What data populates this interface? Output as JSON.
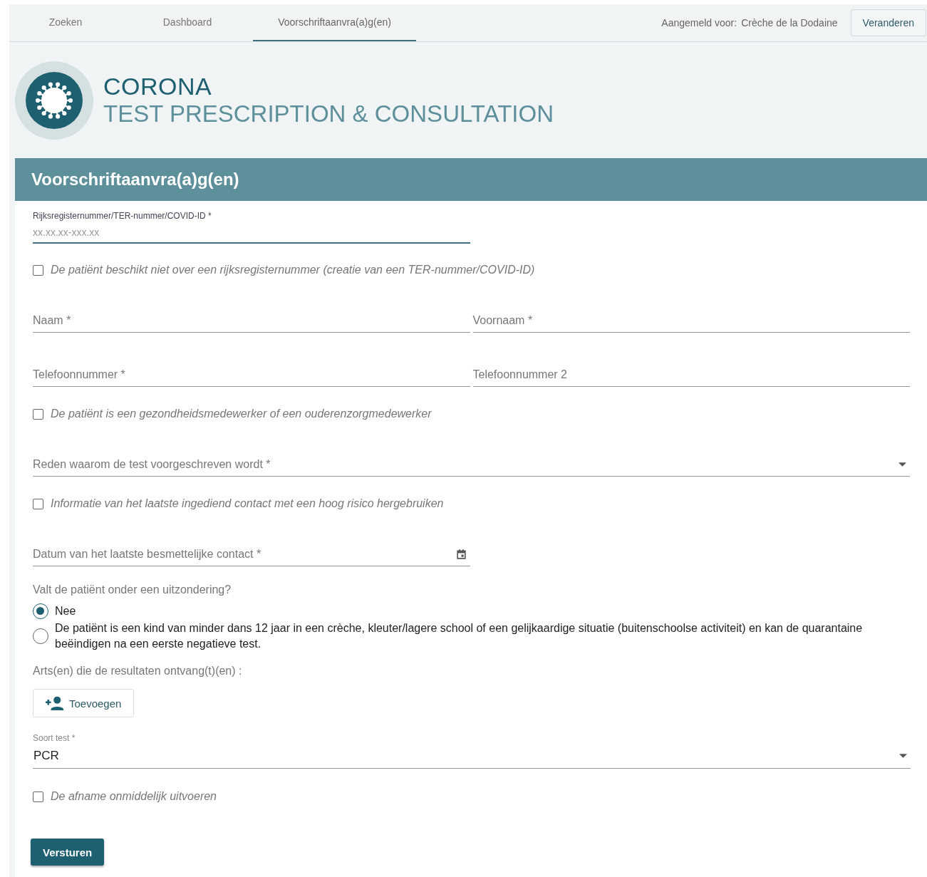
{
  "tabs": [
    {
      "label": "Zoeken",
      "selected": false
    },
    {
      "label": "Dashboard",
      "selected": false
    },
    {
      "label": "Voorschriftaanvra(a)g(en)",
      "selected": true
    }
  ],
  "login": {
    "label": "Aangemeld voor:",
    "value": "Crèche de la Dodaine",
    "button": "Veranderen"
  },
  "header": {
    "title": "CORONA",
    "subtitle": "TEST PRESCRIPTION & CONSULTATION"
  },
  "form": {
    "title": "Voorschriftaanvra(a)g(en)",
    "items": [
      {
        "kind": "focused-text",
        "label": "Rijksregisternummer/TER-nummer/COVID-ID *",
        "placeholder": "xx.xx.xx-xxx.xx"
      },
      {
        "kind": "checkbox",
        "label": "De patiënt beschikt niet over een rijksregisternummer (creatie van een TER-nummer/COVID-ID)",
        "checked": false
      },
      {
        "kind": "pair",
        "fields": [
          {
            "label": "Naam *"
          },
          {
            "label": "Voornaam *"
          }
        ]
      },
      {
        "kind": "pair",
        "fields": [
          {
            "label": "Telefoonnummer *"
          },
          {
            "label": "Telefoonnummer 2"
          }
        ]
      },
      {
        "kind": "checkbox",
        "label": "De patiënt is een gezondheidsmedewerker of een ouderenzorgmedewerker",
        "checked": false
      },
      {
        "kind": "select",
        "label": "Reden waarom de test voorgeschreven wordt *"
      },
      {
        "kind": "checkbox",
        "label": "Informatie van het laatste ingediend contact met een hoog risico hergebruiken",
        "checked": false
      },
      {
        "kind": "date",
        "label": "Datum van het laatste besmettelijke contact *"
      },
      {
        "kind": "radio",
        "question": "Valt de patiënt onder een uitzondering?",
        "options": [
          {
            "label": "Nee",
            "selected": true
          },
          {
            "label": "De patiënt is een kind van minder dans 12 jaar in een crèche, kleuter/lagere school of een gelijkaardige situatie (buitenschoolse activiteit) en kan de quarantaine beëindigen na een eerste negatieve test.",
            "selected": false
          }
        ]
      },
      {
        "kind": "add",
        "label": "Arts(en) die de resultaten ontvang(t)(en) :",
        "button": "Toevoegen"
      },
      {
        "kind": "filled-select",
        "label": "Soort test *",
        "value": "PCR"
      },
      {
        "kind": "checkbox",
        "label": "De afname onmiddelijk uitvoeren",
        "checked": false
      }
    ],
    "submit": "Versturen"
  }
}
